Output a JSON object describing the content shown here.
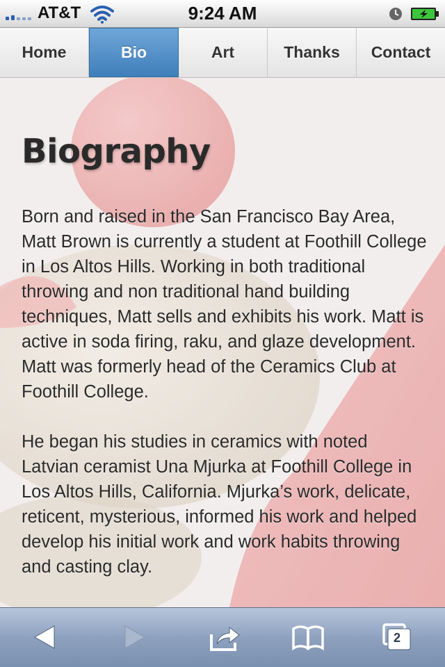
{
  "status_bar": {
    "carrier": "AT&T",
    "time": "9:24 AM"
  },
  "nav": {
    "tabs": [
      {
        "label": "Home",
        "active": false
      },
      {
        "label": "Bio",
        "active": true
      },
      {
        "label": "Art",
        "active": false
      },
      {
        "label": "Thanks",
        "active": false
      },
      {
        "label": "Contact",
        "active": false
      }
    ]
  },
  "page": {
    "title": "Biography",
    "paragraphs": [
      "Born and raised in the San Francisco Bay Area, Matt Brown is currently a student at Foothill College in Los Altos Hills. Working in both traditional throwing and non traditional hand building techniques, Matt sells and exhibits his work. Matt is active in soda firing, raku, and glaze development. Matt was formerly head of the Ceramics Club at Foothill College.",
      "He began his studies in ceramics with noted Latvian ceramist Una Mjurka at Foothill College in Los Altos Hills, California. Mjurka’s work, delicate, reticent, mysterious, informed his work and helped develop his initial work and work habits throwing and casting clay."
    ]
  },
  "toolbar": {
    "pages_count": "2"
  },
  "colors": {
    "active_tab": "#4f8cc6",
    "toolbar": "#8ea2bf",
    "battery_green": "#3cc63c"
  }
}
